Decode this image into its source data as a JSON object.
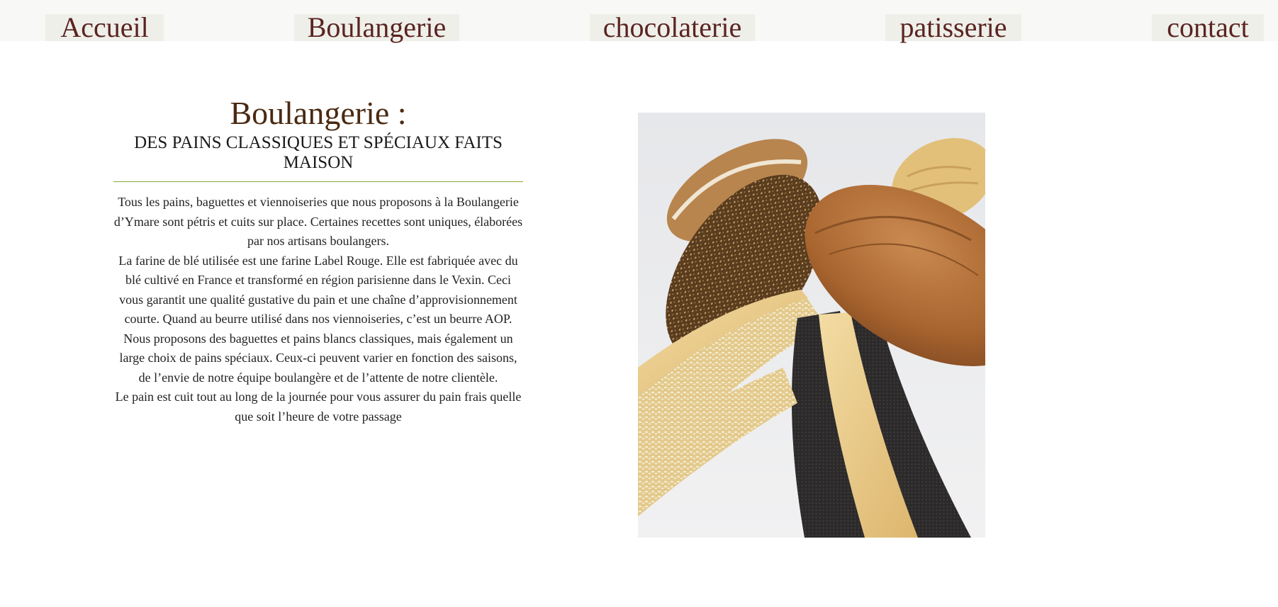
{
  "nav": {
    "items": [
      {
        "label": "Accueil"
      },
      {
        "label": "Boulangerie"
      },
      {
        "label": "chocolaterie"
      },
      {
        "label": "patisserie"
      },
      {
        "label": "contact"
      }
    ]
  },
  "main": {
    "title": "Boulangerie :",
    "subtitle": "DES PAINS CLASSIQUES ET SPÉCIAUX FAITS MAISON",
    "paragraphs": [
      "Tous les pains, baguettes et viennoiseries que nous proposons à la Boulangerie d’Ymare sont pétris et cuits sur place. Certaines recettes sont uniques, élaborées par nos artisans boulangers.",
      "La farine de blé utilisée est une farine Label Rouge. Elle est fabriquée avec du blé cultivé en France et transformé en région parisienne dans le Vexin. Ceci vous garantit une qualité gustative du pain et une chaîne d’approvisionnement courte. Quand au beurre utilisé dans nos viennoiseries, c’est un beurre AOP.",
      "Nous proposons des baguettes et pains blancs classiques, mais également un large choix de pains spéciaux. Ceux-ci peuvent varier en fonction des saisons, de l’envie de notre équipe boulangère et de l’attente de notre clientèle.",
      "Le pain est cuit tout au long de la journée pour vous assurer du pain frais quelle que soit l’heure de votre passage"
    ]
  },
  "colors": {
    "nav_text": "#5a2420",
    "title": "#4a2a12",
    "divider": "#8aa83c"
  }
}
